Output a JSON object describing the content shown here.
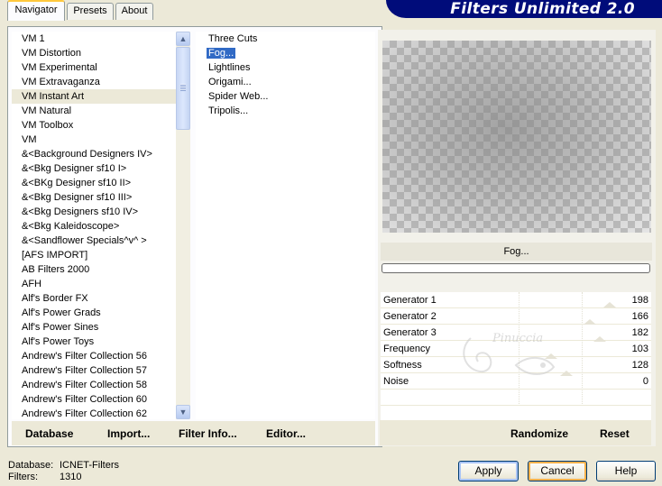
{
  "banner": {
    "title": "Filters Unlimited 2.0"
  },
  "tabs": [
    {
      "label": "Navigator",
      "active": true
    },
    {
      "label": "Presets",
      "active": false
    },
    {
      "label": "About",
      "active": false
    }
  ],
  "categories": [
    {
      "label": "VM 1"
    },
    {
      "label": "VM Distortion"
    },
    {
      "label": "VM Experimental"
    },
    {
      "label": "VM Extravaganza"
    },
    {
      "label": "VM Instant Art",
      "selected": true
    },
    {
      "label": "VM Natural"
    },
    {
      "label": "VM Toolbox"
    },
    {
      "label": "VM"
    },
    {
      "label": "&<Background Designers IV>"
    },
    {
      "label": "&<Bkg Designer sf10 I>"
    },
    {
      "label": "&<BKg Designer sf10 II>"
    },
    {
      "label": "&<Bkg Designer sf10 III>"
    },
    {
      "label": "&<Bkg Designers sf10 IV>"
    },
    {
      "label": "&<Bkg Kaleidoscope>"
    },
    {
      "label": "&<Sandflower Specials^v^ >"
    },
    {
      "label": "[AFS IMPORT]"
    },
    {
      "label": "AB Filters 2000"
    },
    {
      "label": "AFH"
    },
    {
      "label": "Alf's Border FX"
    },
    {
      "label": "Alf's Power Grads"
    },
    {
      "label": "Alf's Power Sines"
    },
    {
      "label": "Alf's Power Toys"
    },
    {
      "label": "Andrew's Filter Collection 56"
    },
    {
      "label": "Andrew's Filter Collection 57"
    },
    {
      "label": "Andrew's Filter Collection 58"
    },
    {
      "label": "Andrew's Filter Collection 60"
    },
    {
      "label": "Andrew's Filter Collection 62"
    }
  ],
  "filters": [
    {
      "label": "Three Cuts"
    },
    {
      "label": "Fog...",
      "selected": true
    },
    {
      "label": "Lightlines"
    },
    {
      "label": "Origami..."
    },
    {
      "label": "Spider Web..."
    },
    {
      "label": "Tripolis..."
    }
  ],
  "bottom_buttons": {
    "database": "Database",
    "import": "Import...",
    "filter_info": "Filter Info...",
    "editor": "Editor..."
  },
  "filter_name": "Fog...",
  "progress": 0,
  "parameters": [
    {
      "label": "Generator 1",
      "value": "198"
    },
    {
      "label": "Generator 2",
      "value": "166"
    },
    {
      "label": "Generator 3",
      "value": "182"
    },
    {
      "label": "Frequency",
      "value": "103"
    },
    {
      "label": "Softness",
      "value": "128"
    },
    {
      "label": "Noise",
      "value": "0"
    }
  ],
  "right_buttons": {
    "randomize": "Randomize",
    "reset": "Reset"
  },
  "watermark": "Pinuccia",
  "status": {
    "database_label": "Database:",
    "database_value": "ICNET-Filters",
    "filters_label": "Filters:",
    "filters_value": "1310"
  },
  "dialog_buttons": {
    "apply": "Apply",
    "cancel": "Cancel",
    "help": "Help"
  },
  "icons": {
    "scroll_up": "arrow-up-icon",
    "scroll_down": "arrow-down-icon"
  },
  "colors": {
    "banner": "#000c7a",
    "selection": "#316ac5",
    "tab_accent": "#ffc83c"
  }
}
